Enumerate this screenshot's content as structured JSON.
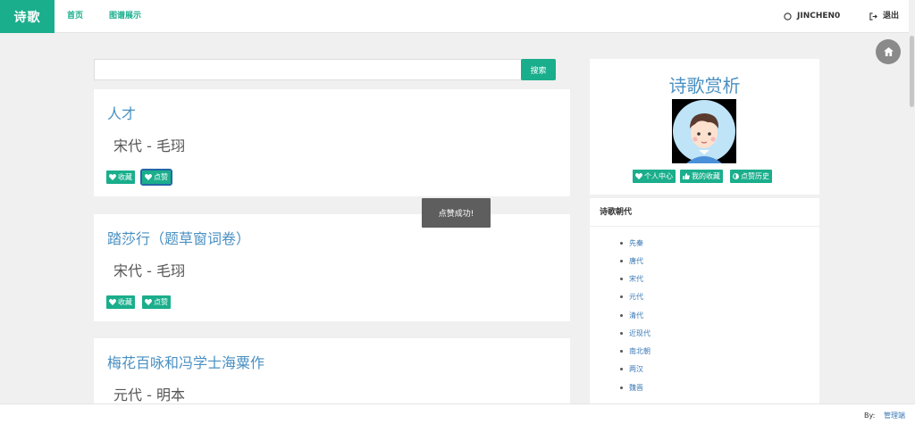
{
  "navbar": {
    "brand": "诗歌",
    "links": [
      "首页",
      "图谱展示"
    ],
    "username": "JINCHEN0",
    "logout": "退出"
  },
  "search": {
    "placeholder": "",
    "button": "搜索"
  },
  "poems": [
    {
      "title": "人才",
      "author": "宋代 - 毛珝",
      "collect": "收藏",
      "like": "点赞"
    },
    {
      "title": "踏莎行（题草窗词卷）",
      "author": "宋代 - 毛珝",
      "collect": "收藏",
      "like": "点赞"
    },
    {
      "title": "梅花百咏和冯学士海粟作",
      "author": "元代 - 明本"
    }
  ],
  "toast": "点赞成功!",
  "profile": {
    "title": "诗歌赏析",
    "buttons": [
      "个人中心",
      "我的收藏",
      "点赞历史"
    ]
  },
  "dynasties": {
    "heading": "诗歌朝代",
    "items": [
      "先秦",
      "唐代",
      "宋代",
      "元代",
      "清代",
      "近现代",
      "南北朝",
      "两汉",
      "魏晋"
    ]
  },
  "footer": {
    "by_label": "By:",
    "by_link": "管理端"
  },
  "colors": {
    "accent": "#1aae8c",
    "link": "#4a90c2",
    "toast_bg": "#5e5e5e"
  }
}
